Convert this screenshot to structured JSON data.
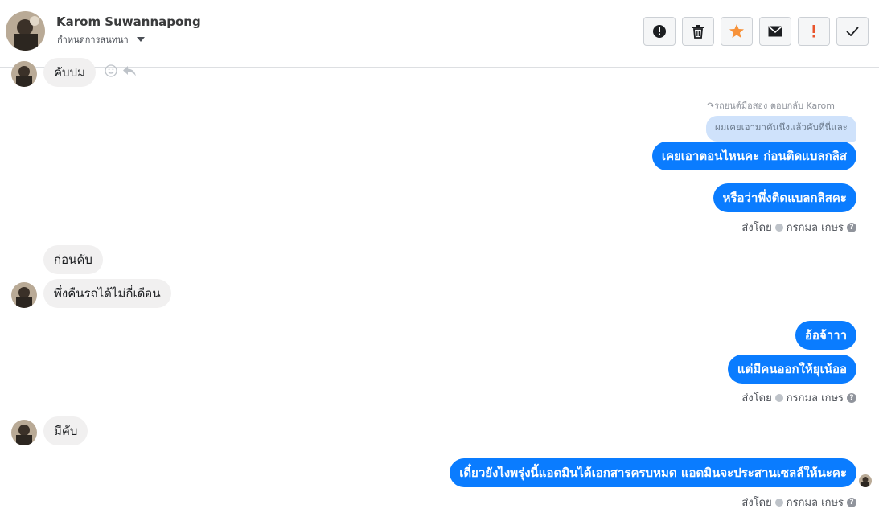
{
  "header": {
    "name": "Karom Suwannapong",
    "settings_label": "กำหนดการสนทนา"
  },
  "toolbar": {
    "icons": [
      "alert-circle-icon",
      "trash-icon",
      "star-icon",
      "envelope-icon",
      "exclamation-icon",
      "check-icon"
    ],
    "star_color": "#f7923a",
    "flag_color": "#e9542c"
  },
  "messages": {
    "m0": "คับปม",
    "reply_meta": "รถยนต์มือสอง ตอบกลับ Karom",
    "quoted": "ผมเคยเอามาคันนึงแล้วคับที่นี่และ",
    "m1": "เคยเอาตอนไหนคะ ก่อนติดแบลกลิส",
    "m2": "หรือว่าพึ่งติดแบลกลิสคะ",
    "sent1_prefix": "ส่งโดย",
    "sent1_name": "กรกมล เกษร",
    "m3": "ก่อนคับ",
    "m4": "พึ่งคืนรถได้ไม่กี่เดือน",
    "m5": "อ้อจ้าาา",
    "m6": "แต่มีคนออกให้ยุเน้ออ",
    "sent2_prefix": "ส่งโดย",
    "sent2_name": "กรกมล เกษร",
    "m7": "มีคับ",
    "m8": "เดี๋ยวยังไงพรุ่งนี้แอดมินได้เอกสารครบหมด แอดมินจะประสานเซลล์ให้นะคะ",
    "sent3_prefix": "ส่งโดย",
    "sent3_name": "กรกมล เกษร"
  },
  "colors": {
    "outgoing": "#0a7cff",
    "incoming": "#f1f0f0",
    "quoted": "#cfe2fb"
  }
}
